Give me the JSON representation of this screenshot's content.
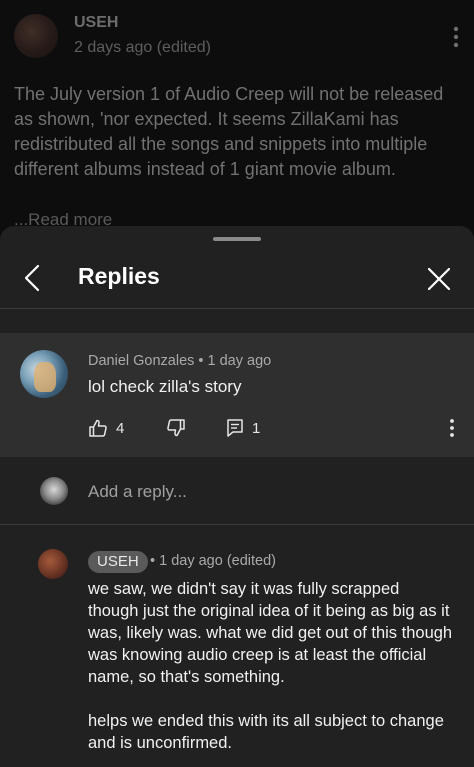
{
  "post": {
    "author": "USEH",
    "meta": "2 days ago (edited)",
    "text": "The July version 1 of Audio Creep will not be released as shown, 'nor expected. It seems ZillaKami has redistributed all the songs and snippets into multiple different albums instead of 1 giant movie album.",
    "read_more": "...Read more"
  },
  "sheet": {
    "title": "Replies"
  },
  "parent_comment": {
    "author_meta": "Daniel Gonzales • 1 day ago",
    "text": "lol check zilla's story",
    "likes": "4",
    "replies": "1"
  },
  "add_reply": {
    "placeholder": "Add a reply..."
  },
  "reply": {
    "author": "USEH",
    "meta": "• 1 day ago (edited)",
    "paragraph1": "we saw, we didn't say it was fully scrapped though just the original idea of it being as big as it was, likely was. what we did get out of this though was knowing audio creep is at least the official name, so that's something.",
    "paragraph2": "helps we ended this with its all subject to change and is unconfirmed."
  },
  "colors": {
    "background": "#0f0f0f",
    "sheet": "#212121",
    "highlight": "#2f2f2f",
    "badge": "#5a5a5a"
  },
  "icons": [
    "kebab-icon",
    "back-icon",
    "close-icon",
    "like-icon",
    "dislike-icon",
    "reply-icon"
  ]
}
